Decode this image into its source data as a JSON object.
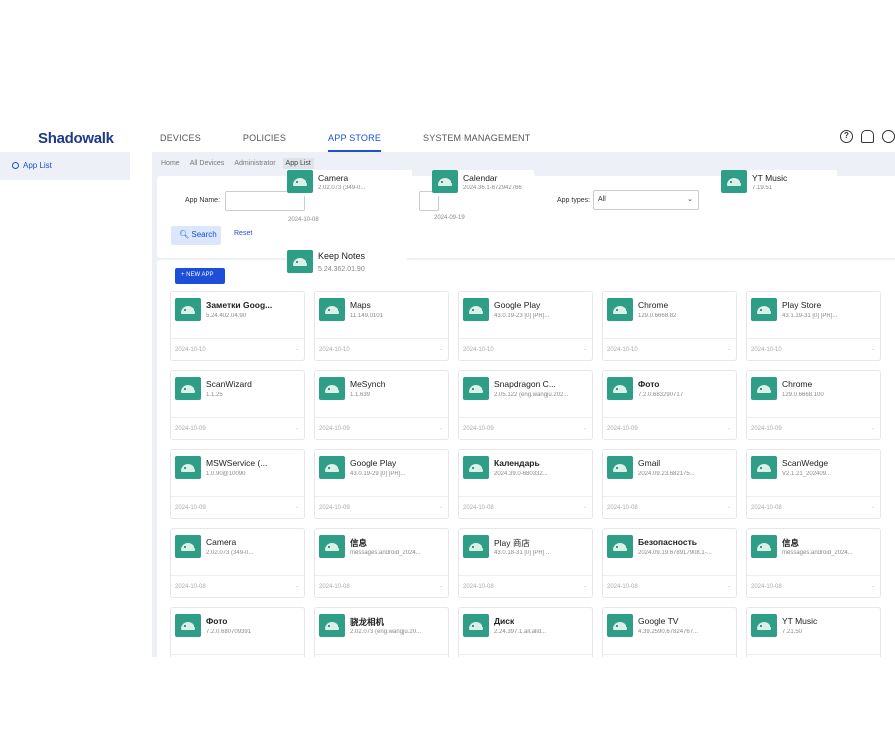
{
  "header": {
    "logo": "Shadowalk",
    "nav": [
      "DEVICES",
      "POLICIES",
      "APP STORE",
      "SYSTEM MANAGEMENT"
    ],
    "icons": [
      "help-icon",
      "bell-icon",
      "user-icon"
    ]
  },
  "sidebar": {
    "items": [
      {
        "label": "App List",
        "icon": "android-icon"
      }
    ]
  },
  "breadcrumbs": [
    "Home",
    "All Devices",
    "Administrator",
    "App List"
  ],
  "search": {
    "app_name_label": "App Name:",
    "app_types_label": "App types:",
    "app_types_value": "All",
    "search_label": "Search",
    "reset_label": "Reset"
  },
  "list": {
    "new_app_label": "+ NEW APP"
  },
  "overlay": [
    {
      "name": "Camera",
      "version": "2.02.073 (349-0...",
      "date": "2024-10-08"
    },
    {
      "name": "Calendar",
      "version": "2024.36.1-672942766",
      "date": "2024-09-19"
    },
    {
      "name": "YT Music",
      "version": "7.19.51",
      "date": ""
    },
    {
      "name": "Keep Notes",
      "version": "5.24.362.01.90",
      "date": ""
    }
  ],
  "apps": [
    {
      "name": "Заметки Goog...",
      "version": "5.24.402.04.90",
      "date": "2024-10-10",
      "bold": true
    },
    {
      "name": "Maps",
      "version": "11.149.0101",
      "date": "2024-10-10",
      "bold": false
    },
    {
      "name": "Google Play",
      "version": "43.0.19-23 [0] [PR]...",
      "date": "2024-10-10",
      "bold": false
    },
    {
      "name": "Chrome",
      "version": "129.0.6668.82",
      "date": "2024-10-10",
      "bold": false
    },
    {
      "name": "Play Store",
      "version": "43.1.19-31 [0] [PR]...",
      "date": "2024-10-10",
      "bold": false
    },
    {
      "name": "ScanWizard",
      "version": "1.1.25",
      "date": "2024-10-09",
      "bold": false
    },
    {
      "name": "MeSynch",
      "version": "1.1.639",
      "date": "2024-10-09",
      "bold": false
    },
    {
      "name": "Snapdragon C...",
      "version": "2.05.122 (eng.wangju.202...",
      "date": "2024-10-09",
      "bold": false
    },
    {
      "name": "Фото",
      "version": "7.2.0.683290717",
      "date": "2024-10-09",
      "bold": true
    },
    {
      "name": "Chrome",
      "version": "129.0.6668.100",
      "date": "2024-10-09",
      "bold": false
    },
    {
      "name": "MSWService (...",
      "version": "1.0.90@10090",
      "date": "2024-10-09",
      "bold": false
    },
    {
      "name": "Google Play",
      "version": "43.0.19-29 [0] [PR]...",
      "date": "2024-10-09",
      "bold": false
    },
    {
      "name": "Календарь",
      "version": "2024.39.0-680332...",
      "date": "2024-10-08",
      "bold": true
    },
    {
      "name": "Gmail",
      "version": "2024.09.23.682175...",
      "date": "2024-10-08",
      "bold": false
    },
    {
      "name": "ScanWedge",
      "version": "V2.1.21_202409...",
      "date": "2024-10-08",
      "bold": false
    },
    {
      "name": "Camera",
      "version": "2.02.073 (349-0...",
      "date": "2024-10-08",
      "bold": false
    },
    {
      "name": "信息",
      "version": "messages.android_2024...",
      "date": "2024-10-08",
      "bold": true
    },
    {
      "name": "Play 商店",
      "version": "43.0.18-31 [0] [PR] ...",
      "date": "2024-10-08",
      "bold": false
    },
    {
      "name": "Безопасность",
      "version": "2024.09.19.678917908.1-...",
      "date": "2024-10-08",
      "bold": true
    },
    {
      "name": "信息",
      "version": "messages.android_2024...",
      "date": "2024-10-08",
      "bold": true
    },
    {
      "name": "Фото",
      "version": "7.2.0.680709391",
      "date": "",
      "bold": true
    },
    {
      "name": "骁龙相机",
      "version": "2.02.073 (eng.wangju.20...",
      "date": "",
      "bold": true
    },
    {
      "name": "Диск",
      "version": "2.24.397.1.all.alld...",
      "date": "",
      "bold": true
    },
    {
      "name": "Google TV",
      "version": "4.39.2590.67824767...",
      "date": "",
      "bold": false
    },
    {
      "name": "YT Music",
      "version": "7.21.50",
      "date": "",
      "bold": false
    }
  ],
  "dash": "-"
}
